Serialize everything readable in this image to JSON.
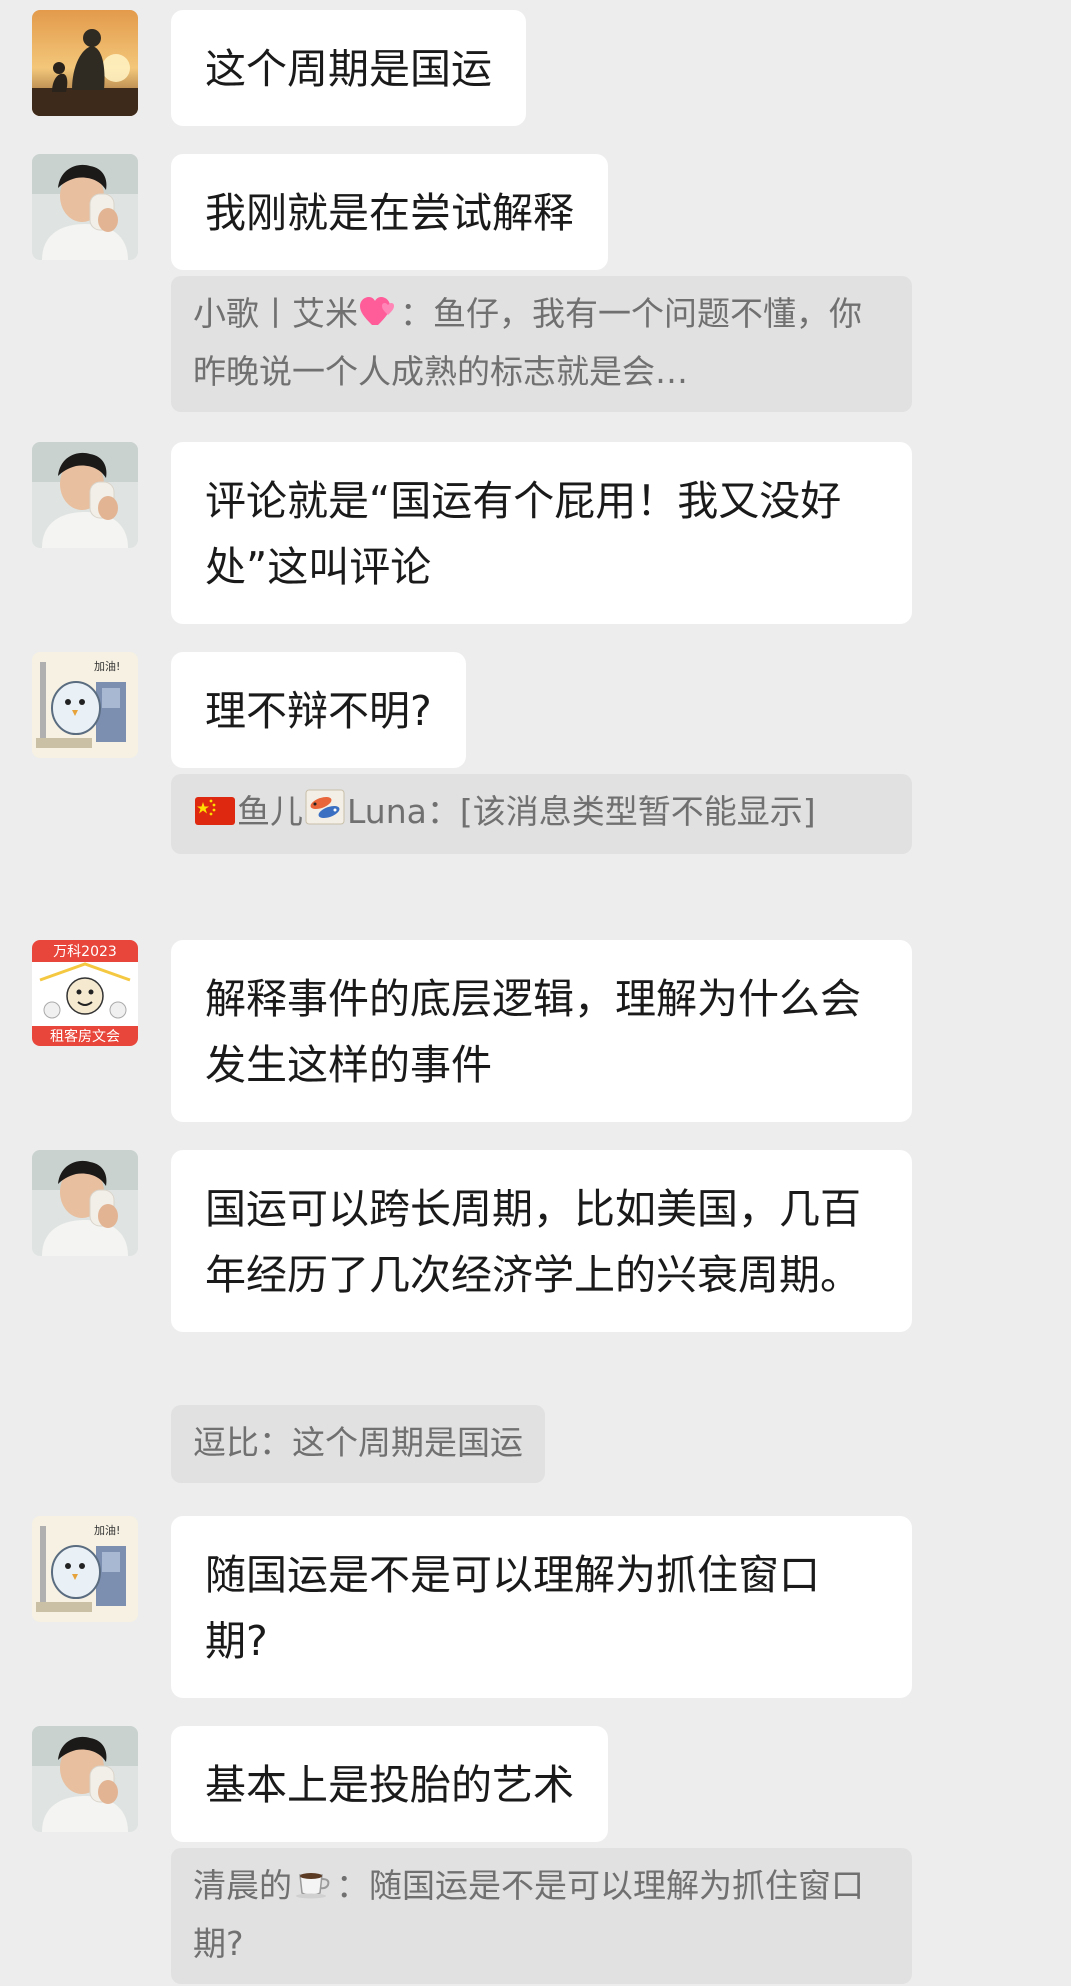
{
  "messages": [
    {
      "text": "这个周期是国运"
    },
    {
      "text": "我刚就是在尝试解释",
      "quote": {
        "sender": "小歌丨艾米",
        "sep": "：",
        "text": "鱼仔，我有一个问题不懂，你昨晚说一个人成熟的标志就是会…"
      }
    },
    {
      "text": "评论就是“国运有个屁用！我又没好处”这叫评论"
    },
    {
      "text": "理不辩不明?",
      "quote": {
        "sender": "鱼儿",
        "sender2": "Luna",
        "sep": "：",
        "text": "[该消息类型暂不能显示]"
      }
    },
    {
      "text": "解释事件的底层逻辑，理解为什么会发生这样的事件"
    },
    {
      "text": "国运可以跨长周期，比如美国，几百年经历了几次经济学上的兴衰周期。",
      "quote": {
        "sender": "逗比",
        "sep": "：",
        "text": "这个周期是国运"
      }
    },
    {
      "text": "随国运是不是可以理解为抓住窗口期?"
    },
    {
      "text": "基本上是投胎的艺术",
      "quote": {
        "sender": "清晨的",
        "sep": "：",
        "text": "随国运是不是可以理解为抓住窗口期?"
      }
    }
  ],
  "avatars": {
    "a3_text_top": "加油!",
    "a5_text_top": "万科2023",
    "a5_text_bottom": "租客房文会"
  },
  "icons": [
    "sunset-avatar",
    "man-drinking-avatar",
    "cartoon-bird-avatar",
    "vanke-sticker-avatar",
    "heart-emoji",
    "china-flag-emoji",
    "koi-fish-emoji",
    "coffee-emoji"
  ]
}
